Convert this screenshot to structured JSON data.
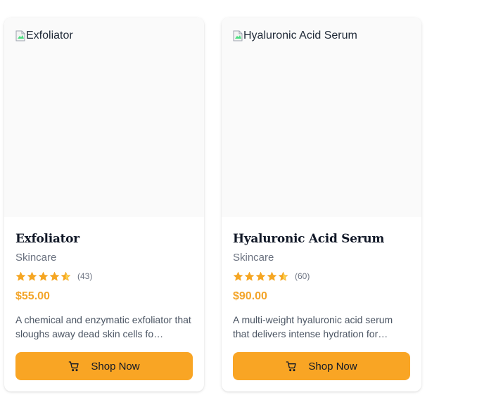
{
  "products": [
    {
      "image_alt": "Exfoliator",
      "title": "Exfoliator",
      "category": "Skincare",
      "rating": 4.5,
      "review_count": "(43)",
      "price": "$55.00",
      "description": "A chemical and enzymatic exfoliator that sloughs away dead skin cells fo…",
      "button_label": "Shop Now",
      "button_icon": "cart-icon"
    },
    {
      "image_alt": "Hyaluronic Acid Serum",
      "title": "Hyaluronic Acid Serum",
      "category": "Skincare",
      "rating": 4.5,
      "review_count": "(60)",
      "price": "$90.00",
      "description": "A multi-weight hyaluronic acid serum that delivers intense hydration for…",
      "button_label": "Shop Now",
      "button_icon": "cart-icon"
    }
  ],
  "colors": {
    "accent": "#f9a524",
    "price": "#f3a52a",
    "star": "#f5a623",
    "star_half_light": "#fcd34d"
  }
}
